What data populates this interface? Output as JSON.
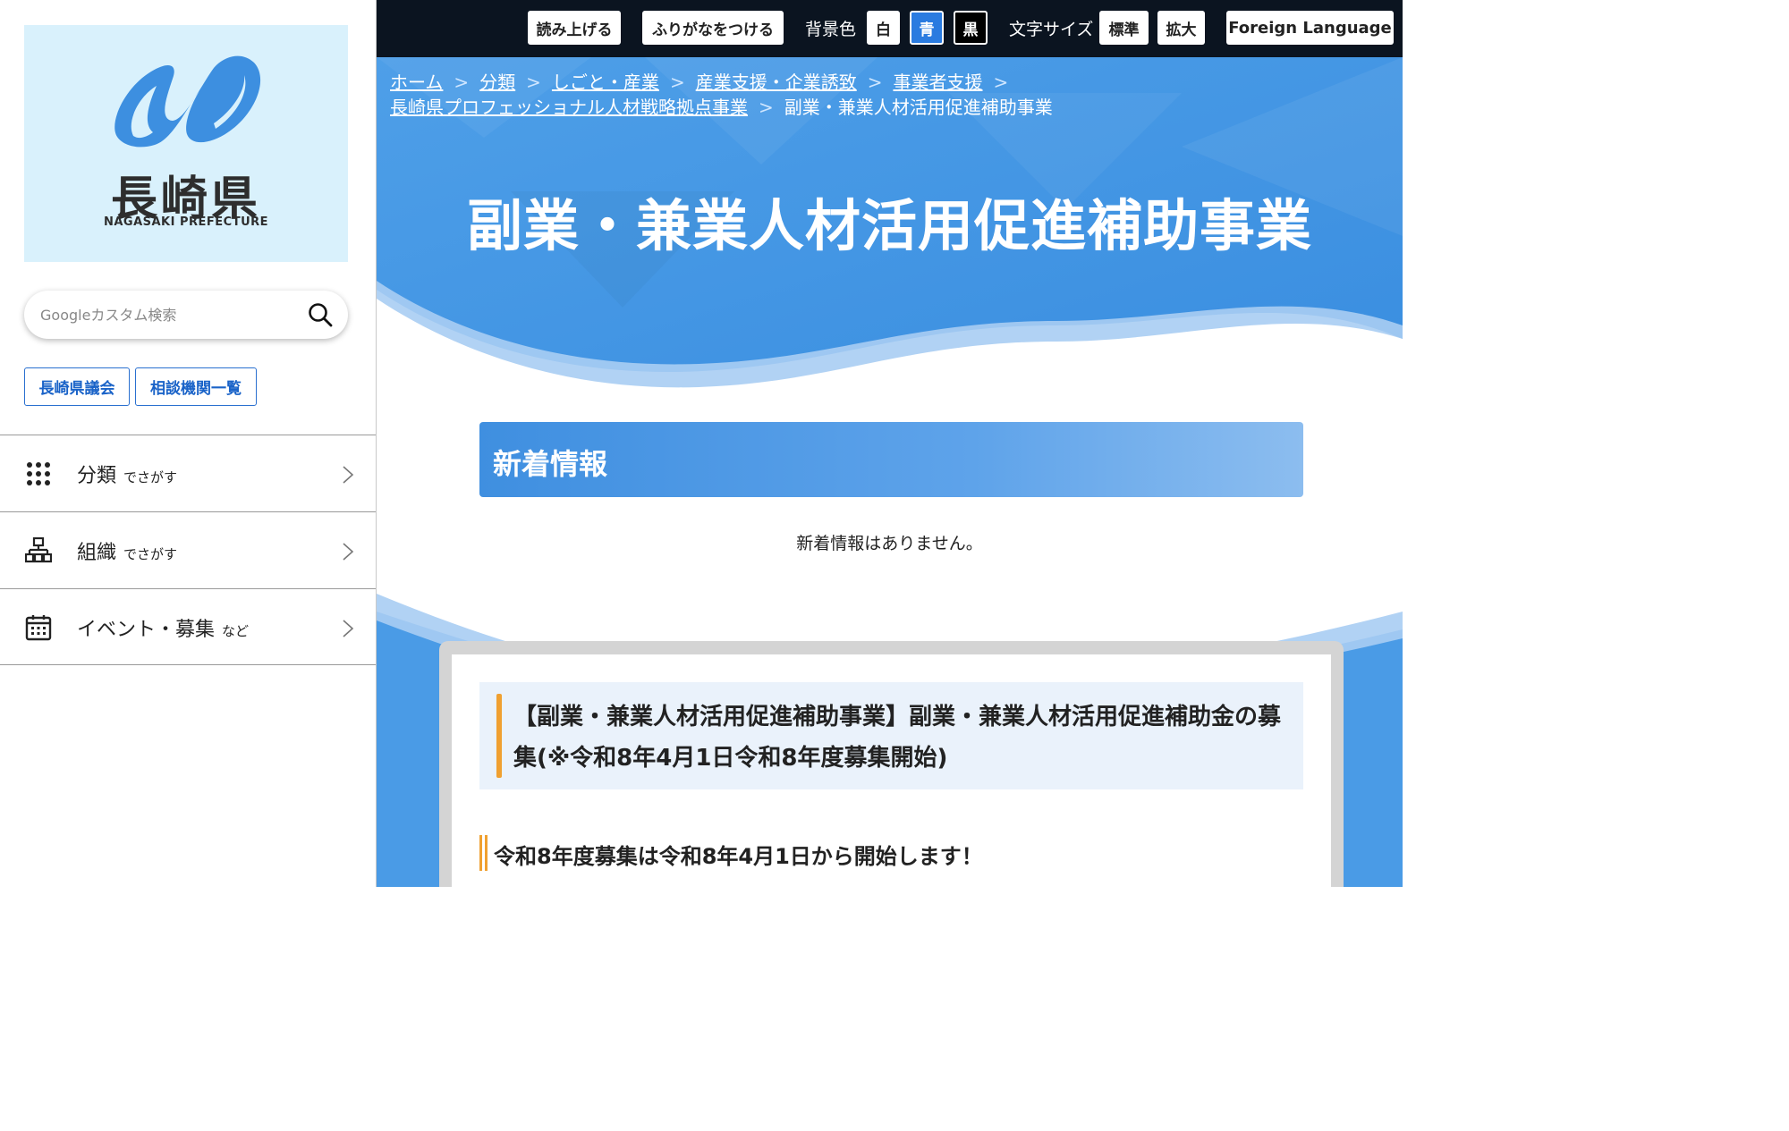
{
  "sidebar": {
    "logo_jp": "長崎県",
    "logo_en": "NAGASAKI PREFECTURE",
    "search_placeholder": "Googleカスタム検索",
    "links": [
      "長崎県議会",
      "相談機関一覧"
    ],
    "nav": [
      {
        "label": "分類",
        "sub": "でさがす",
        "icon": "grid-dots-icon"
      },
      {
        "label": "組織",
        "sub": "でさがす",
        "icon": "org-chart-icon"
      },
      {
        "label": "イベント・募集",
        "sub": "など",
        "icon": "calendar-icon"
      }
    ]
  },
  "topbar": {
    "read_aloud": "読み上げる",
    "furigana": "ふりがなをつける",
    "bg_color_label": "背景色",
    "bg_white": "白",
    "bg_blue": "青",
    "bg_black": "黒",
    "font_size_label": "文字サイズ",
    "size_standard": "標準",
    "size_large": "拡大",
    "foreign_language": "Foreign Language"
  },
  "breadcrumb": {
    "items": [
      "ホーム",
      "分類",
      "しごと・産業",
      "産業支援・企業誘致",
      "事業者支援",
      "長崎県プロフェッショナル人材戦略拠点事業"
    ],
    "current": "副業・兼業人材活用促進補助事業"
  },
  "main": {
    "page_title": "副業・兼業人材活用促進補助事業",
    "news_heading": "新着情報",
    "news_empty": "新着情報はありません。",
    "article_heading": "【副業・兼業人材活用促進補助事業】副業・兼業人材活用促進補助金の募集(※令和8年4月1日令和8年度募集開始)",
    "sub_heading": "令和8年度募集は令和8年4月1日から開始します！"
  },
  "colors": {
    "topbar_bg": "#0b1420",
    "hero_blue": "#4a9be6",
    "link_blue": "#1a63c8",
    "accent_orange": "#f0a030"
  }
}
